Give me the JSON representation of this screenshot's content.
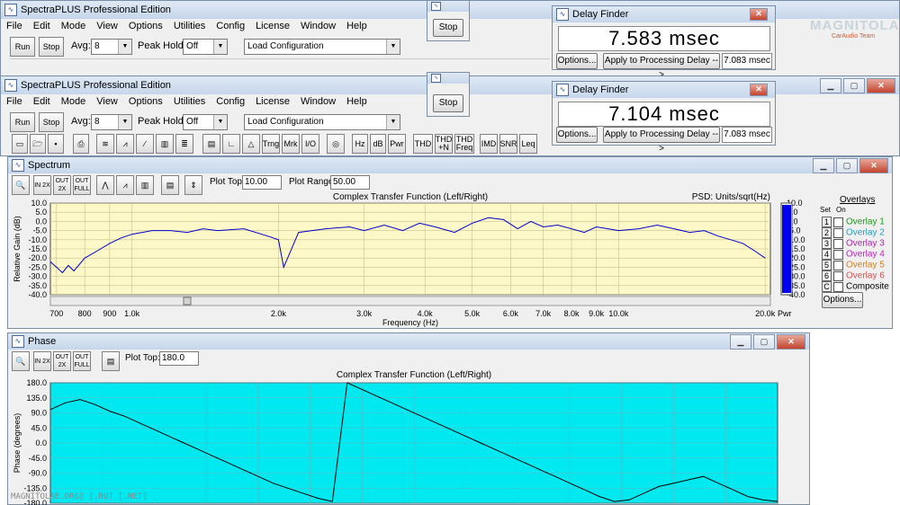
{
  "app": {
    "title": "SpectraPLUS Professional Edition",
    "menu": [
      "File",
      "Edit",
      "Mode",
      "View",
      "Options",
      "Utilities",
      "Config",
      "License",
      "Window",
      "Help"
    ],
    "avg_label": "Avg:",
    "avg_value": "8",
    "peak_hold_label": "Peak Hold:",
    "peak_hold_value": "Off",
    "config_value": "Load Configuration",
    "run_label": "Run",
    "stop_label": "Stop",
    "toolbar_text_buttons": [
      "Trng",
      "Mrk",
      "I/O",
      "Hz",
      "dB",
      "Pwr",
      "THD",
      "THD +N",
      "THD Freq",
      "IMD",
      "SNR",
      "Leq"
    ],
    "stop_dialog_label": "Stop"
  },
  "delay_finder_top": {
    "title": "Delay Finder",
    "value": "7.583 msec",
    "options_label": "Options...",
    "apply_label": "Apply to Processing Delay -->",
    "delay_field": "7.083 msec"
  },
  "delay_finder_bottom": {
    "title": "Delay Finder",
    "value": "7.104 msec",
    "options_label": "Options...",
    "apply_label": "Apply to Processing Delay -->",
    "delay_field": "7.083 msec"
  },
  "watermark": {
    "brand": "MAGNITOLA",
    "sub": "CarAudio Team",
    "footer": "MAGNITOLAE.ORG] [.RU] [.NET]"
  },
  "spectrum": {
    "title": "Spectrum",
    "plot_top_label": "Plot Top:",
    "plot_top_value": "10.00",
    "plot_range_label": "Plot Range:",
    "plot_range_value": "50.00",
    "overlays": {
      "title": "Overlays",
      "col_set": "Set",
      "col_on": "On",
      "items": [
        {
          "num": "1",
          "label": "Overlay 1",
          "color": "#1a9a1a"
        },
        {
          "num": "2",
          "label": "Overlay 2",
          "color": "#20a0c0"
        },
        {
          "num": "3",
          "label": "Overlay 3",
          "color": "#b020b0"
        },
        {
          "num": "4",
          "label": "Overlay 4",
          "color": "#c020c0"
        },
        {
          "num": "5",
          "label": "Overlay 5",
          "color": "#d08020"
        },
        {
          "num": "6",
          "label": "Overlay 6",
          "color": "#e05050"
        },
        {
          "num": "C",
          "label": "Composite",
          "color": "#000000"
        }
      ],
      "options_label": "Options..."
    },
    "pwr_label": "Pwr"
  },
  "phase": {
    "title": "Phase",
    "plot_top_label": "Plot Top:",
    "plot_top_value": "180.0"
  },
  "chart_data": [
    {
      "type": "line",
      "title": "Complex Transfer Function (Left/Right)",
      "subtitle": "PSD: Units/sqrt(Hz)",
      "xlabel": "Frequency (Hz)",
      "ylabel": "Relative Gain (dB)",
      "xscale": "log",
      "xlim": [
        680,
        20500
      ],
      "ylim": [
        -40,
        10
      ],
      "xticks": [
        700,
        800,
        900,
        1000,
        2000,
        3000,
        4000,
        5000,
        6000,
        7000,
        8000,
        9000,
        10000,
        20000
      ],
      "xtick_labels": [
        "700",
        "800",
        "900",
        "1.0k",
        "2.0k",
        "3.0k",
        "4.0k",
        "5.0k",
        "6.0k",
        "7.0k",
        "8.0k",
        "9.0k",
        "10.0k",
        "20.0k"
      ],
      "yticks": [
        "10.0",
        "5.0",
        "0.0",
        "-5.0",
        "-10.0",
        "-15.0",
        "-20.0",
        "-25.0",
        "-30.0",
        "-35.0",
        "-40.0"
      ],
      "grid": true,
      "series": [
        {
          "color": "#0000cc",
          "x": [
            680,
            700,
            720,
            740,
            760,
            800,
            850,
            900,
            950,
            1000,
            1100,
            1200,
            1300,
            1400,
            1500,
            1700,
            1900,
            2000,
            2050,
            2200,
            2500,
            2800,
            3000,
            3300,
            3600,
            3900,
            4200,
            4600,
            5000,
            5400,
            5800,
            6200,
            6600,
            7000,
            7500,
            8000,
            8500,
            9000,
            9500,
            10000,
            11000,
            12000,
            13000,
            14000,
            15000,
            16000,
            17000,
            18000,
            19000,
            20000
          ],
          "y": [
            -22,
            -25,
            -28,
            -24,
            -27,
            -20,
            -16,
            -12,
            -9,
            -7,
            -5,
            -5,
            -6,
            -4,
            -5,
            -4,
            -8,
            -10,
            -25,
            -6,
            -4,
            -3,
            -5,
            -2,
            -5,
            -1,
            -3,
            -6,
            -1,
            2,
            1,
            -4,
            0,
            -3,
            -2,
            -4,
            -6,
            -3,
            -4,
            -5,
            -4,
            -2,
            -4,
            -6,
            -5,
            -8,
            -10,
            -12,
            -16,
            -20
          ]
        }
      ]
    },
    {
      "type": "line",
      "title": "Complex Transfer Function (Left/Right)",
      "ylabel": "Phase (degrees)",
      "ylim": [
        -180,
        180
      ],
      "yticks": [
        "180.0",
        "135.0",
        "90.0",
        "45.0",
        "0.0",
        "-45.0",
        "-90.0",
        "-135.0",
        "-180.0"
      ],
      "grid": true,
      "series": [
        {
          "color": "#000000",
          "y": [
            100,
            120,
            130,
            115,
            95,
            80,
            60,
            40,
            20,
            0,
            -20,
            -40,
            -60,
            -80,
            -100,
            -120,
            -135,
            -150,
            -165,
            -175,
            180,
            160,
            140,
            120,
            100,
            80,
            60,
            40,
            20,
            0,
            -20,
            -40,
            -60,
            -80,
            -100,
            -120,
            -140,
            -160,
            -175,
            -170,
            -150,
            -130,
            -120,
            -110,
            -100,
            -120,
            -140,
            -160,
            -170,
            -175
          ]
        }
      ]
    }
  ]
}
